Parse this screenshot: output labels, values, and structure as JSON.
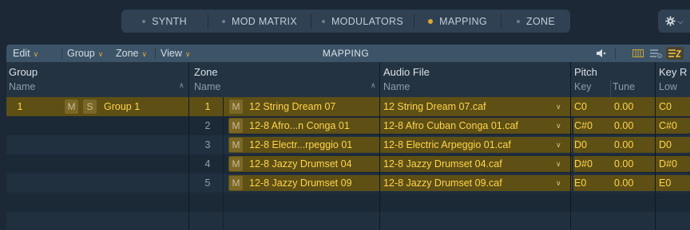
{
  "tabs": [
    {
      "label": "SYNTH",
      "active": false
    },
    {
      "label": "MOD MATRIX",
      "active": false
    },
    {
      "label": "MODULATORS",
      "active": false
    },
    {
      "label": "MAPPING",
      "active": true
    },
    {
      "label": "ZONE",
      "active": false
    }
  ],
  "toolbar": {
    "menus": [
      "Edit",
      "Group",
      "Zone",
      "View"
    ],
    "title": "MAPPING"
  },
  "columns": {
    "group": {
      "title": "Group",
      "sub": "Name"
    },
    "zone": {
      "title": "Zone",
      "sub": "Name"
    },
    "audio": {
      "title": "Audio File",
      "sub": "Name"
    },
    "pitch": {
      "title": "Pitch",
      "sub_key": "Key",
      "sub_tune": "Tune"
    },
    "keyr": {
      "title": "Key R",
      "sub": "Low"
    }
  },
  "group_row": {
    "num": "1",
    "m": "M",
    "s": "S",
    "name": "Group 1"
  },
  "zones": [
    {
      "num": "1",
      "m": "M",
      "name": "12 String Dream 07",
      "file": "12 String Dream 07.caf",
      "key": "C0",
      "tune": "0.00",
      "low": "C0"
    },
    {
      "num": "2",
      "m": "M",
      "name": "12-8 Afro...n Conga 01",
      "file": "12-8 Afro Cuban Conga 01.caf",
      "key": "C#0",
      "tune": "0.00",
      "low": "C#0"
    },
    {
      "num": "3",
      "m": "M",
      "name": "12-8 Electr...rpeggio 01",
      "file": "12-8 Electric Arpeggio 01.caf",
      "key": "D0",
      "tune": "0.00",
      "low": "D0"
    },
    {
      "num": "4",
      "m": "M",
      "name": "12-8 Jazzy Drumset 04",
      "file": "12-8 Jazzy Drumset 04.caf",
      "key": "D#0",
      "tune": "0.00",
      "low": "D#0"
    },
    {
      "num": "5",
      "m": "M",
      "name": "12-8 Jazzy Drumset 09",
      "file": "12-8 Jazzy Drumset 09.caf",
      "key": "E0",
      "tune": "0.00",
      "low": "E0"
    }
  ]
}
